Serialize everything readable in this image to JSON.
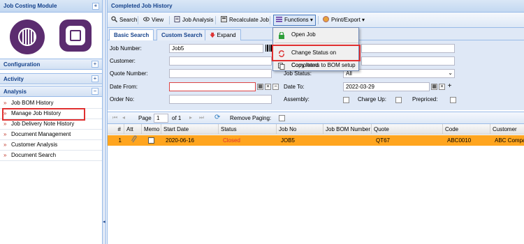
{
  "left": {
    "title": "Job Costing Module",
    "collapse_glyph": "«",
    "sections": [
      {
        "label": "Configuration",
        "toggle": "+"
      },
      {
        "label": "Activity",
        "toggle": "+"
      },
      {
        "label": "Analysis",
        "toggle": "−"
      }
    ],
    "items": [
      "Job BOM History",
      "Manage Job History",
      "Job Delivery Note History",
      "Document Management",
      "Customer Analysis",
      "Document Search"
    ]
  },
  "main": {
    "title": "Completed Job History",
    "toolbar": {
      "search": "Search",
      "view": "View",
      "job_analysis": "Job Analysis",
      "recalculate": "Recalculate Job",
      "functions": "Functions",
      "print_export": "Print/Export"
    },
    "tabs": {
      "basic": "Basic Search",
      "custom": "Custom Search",
      "expand": "Expand"
    },
    "form": {
      "job_number_label": "Job Number:",
      "job_number_value": "Job5",
      "customer_label": "Customer:",
      "quote_number_label": "Quote Number:",
      "job_status_label": "Job Status:",
      "job_status_value": "All",
      "date_from_label": "Date From:",
      "date_to_label": "Date To:",
      "date_to_value": "2022-03-29",
      "order_no_label": "Order No:",
      "assembly_label": "Assembly:",
      "charge_up_label": "Charge Up:",
      "prepriced_label": "Prepriced:"
    },
    "pager": {
      "page_label": "Page",
      "page_value": "1",
      "of_label": "of 1",
      "remove_paging": "Remove Paging:"
    },
    "columns": [
      "#",
      "Att",
      "Memo",
      "Start Date",
      "Status",
      "Job No",
      "Job BOM Number",
      "Quote",
      "Code",
      "Customer"
    ],
    "rows": [
      {
        "num": "1",
        "start_date": "2020-06-16",
        "status": "Closed",
        "job_no": "JOB5",
        "bom": "",
        "quote": "QT67",
        "code": "ABC0010",
        "customer": "ABC Company"
      }
    ]
  },
  "menu": {
    "items": [
      "Open Job",
      "Change Status on Completed",
      "Copy Items to BOM setup"
    ]
  },
  "colors": {
    "accent": "#15428b",
    "row_highlight": "#ffa51f",
    "status_closed": "#e03030",
    "highlight_box": "#e03030"
  }
}
